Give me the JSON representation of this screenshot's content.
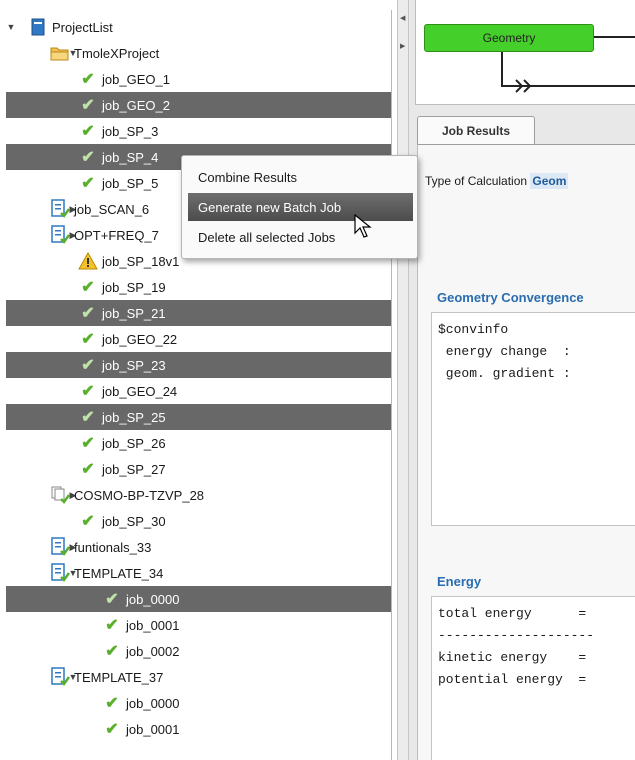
{
  "tree": {
    "rows": [
      {
        "label": "ProjectList",
        "depth": 0,
        "arrow": "▼",
        "icon": "project-list-icon",
        "selected": false
      },
      {
        "label": "TmoleXProject",
        "depth": 1,
        "arrow": "▼",
        "icon": "folder-icon",
        "selected": false
      },
      {
        "label": "job_GEO_1",
        "depth": 2,
        "arrow": "",
        "icon": "check-icon",
        "selected": false
      },
      {
        "label": "job_GEO_2",
        "depth": 2,
        "arrow": "",
        "icon": "check-icon",
        "selected": true
      },
      {
        "label": "job_SP_3",
        "depth": 2,
        "arrow": "",
        "icon": "check-icon",
        "selected": false
      },
      {
        "label": "job_SP_4",
        "depth": 2,
        "arrow": "",
        "icon": "check-icon",
        "selected": true
      },
      {
        "label": "job_SP_5",
        "depth": 2,
        "arrow": "",
        "icon": "check-icon",
        "selected": false
      },
      {
        "label": "job_SCAN_6",
        "depth": 1,
        "arrow": "▶",
        "icon": "batch-job-icon",
        "selected": false
      },
      {
        "label": "OPT+FREQ_7",
        "depth": 1,
        "arrow": "▶",
        "icon": "batch-job-icon",
        "selected": false
      },
      {
        "label": "job_SP_18v1",
        "depth": 2,
        "arrow": "",
        "icon": "warning-icon",
        "selected": false
      },
      {
        "label": "job_SP_19",
        "depth": 2,
        "arrow": "",
        "icon": "check-icon",
        "selected": false
      },
      {
        "label": "job_SP_21",
        "depth": 2,
        "arrow": "",
        "icon": "check-icon",
        "selected": true
      },
      {
        "label": "job_GEO_22",
        "depth": 2,
        "arrow": "",
        "icon": "check-icon",
        "selected": false
      },
      {
        "label": "job_SP_23",
        "depth": 2,
        "arrow": "",
        "icon": "check-icon",
        "selected": true
      },
      {
        "label": "job_GEO_24",
        "depth": 2,
        "arrow": "",
        "icon": "check-icon",
        "selected": false
      },
      {
        "label": "job_SP_25",
        "depth": 2,
        "arrow": "",
        "icon": "check-icon",
        "selected": true
      },
      {
        "label": "job_SP_26",
        "depth": 2,
        "arrow": "",
        "icon": "check-icon",
        "selected": false
      },
      {
        "label": "job_SP_27",
        "depth": 2,
        "arrow": "",
        "icon": "check-icon",
        "selected": false
      },
      {
        "label": "COSMO-BP-TZVP_28",
        "depth": 1,
        "arrow": "▶",
        "icon": "cosmo-job-icon",
        "selected": false
      },
      {
        "label": "job_SP_30",
        "depth": 2,
        "arrow": "",
        "icon": "check-icon",
        "selected": false
      },
      {
        "label": "funtionals_33",
        "depth": 1,
        "arrow": "▶",
        "icon": "batch-job-icon",
        "selected": false
      },
      {
        "label": "TEMPLATE_34",
        "depth": 1,
        "arrow": "▼",
        "icon": "batch-job-icon",
        "selected": false
      },
      {
        "label": "job_0000",
        "depth": 3,
        "arrow": "",
        "icon": "check-icon",
        "selected": true
      },
      {
        "label": "job_0001",
        "depth": 3,
        "arrow": "",
        "icon": "check-icon",
        "selected": false
      },
      {
        "label": "job_0002",
        "depth": 3,
        "arrow": "",
        "icon": "check-icon",
        "selected": false
      },
      {
        "label": "TEMPLATE_37",
        "depth": 1,
        "arrow": "▼",
        "icon": "batch-job-icon",
        "selected": false
      },
      {
        "label": "job_0000",
        "depth": 3,
        "arrow": "",
        "icon": "check-icon",
        "selected": false
      },
      {
        "label": "job_0001",
        "depth": 3,
        "arrow": "",
        "icon": "check-icon",
        "selected": false
      }
    ]
  },
  "context_menu": {
    "items": [
      {
        "label": "Combine Results",
        "highlighted": false
      },
      {
        "label": "Generate new Batch Job",
        "highlighted": true
      },
      {
        "label": "Delete all selected Jobs",
        "highlighted": false
      }
    ]
  },
  "workflow": {
    "node_label": "Geometry",
    "node_color": "#45cf2a"
  },
  "job_results": {
    "tab_label": "Job Results",
    "calc_type_label": "Type of Calculation",
    "calc_type_value": "Geom",
    "geometry_convergence": {
      "title": "Geometry Convergence",
      "lines": [
        "$convinfo",
        " energy change  : ",
        " geom. gradient : "
      ]
    },
    "energy": {
      "title": "Energy",
      "lines": [
        "total energy      =",
        "--------------------",
        "kinetic energy    =",
        "potential energy  ="
      ]
    }
  },
  "colors": {
    "selection": "#686868",
    "check": "#5ab02d",
    "section_title": "#2a6cb0"
  }
}
